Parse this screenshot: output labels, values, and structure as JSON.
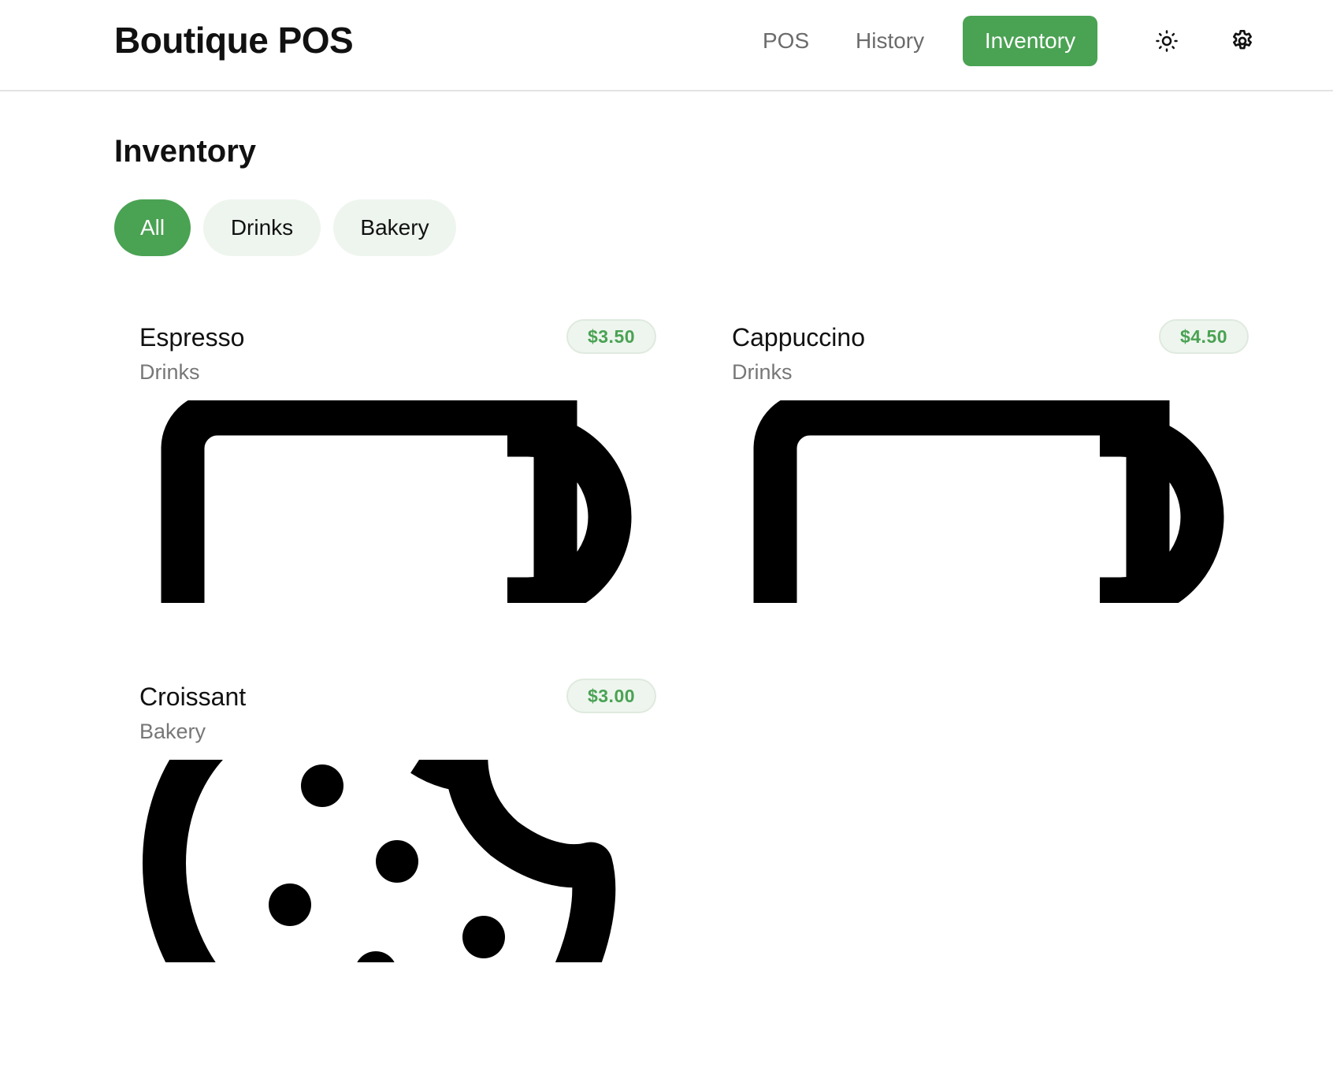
{
  "header": {
    "title": "Boutique POS",
    "nav": [
      {
        "label": "POS",
        "active": false
      },
      {
        "label": "History",
        "active": false
      },
      {
        "label": "Inventory",
        "active": true
      }
    ],
    "theme_icon": "sun-icon",
    "settings_icon": "gear-icon"
  },
  "page": {
    "title": "Inventory",
    "filters": [
      {
        "label": "All",
        "active": true
      },
      {
        "label": "Drinks",
        "active": false
      },
      {
        "label": "Bakery",
        "active": false
      }
    ]
  },
  "products": [
    {
      "name": "Espresso",
      "category": "Drinks",
      "price": "$3.50",
      "icon": "coffee-cup-icon"
    },
    {
      "name": "Cappuccino",
      "category": "Drinks",
      "price": "$4.50",
      "icon": "coffee-cup-icon"
    },
    {
      "name": "Croissant",
      "category": "Bakery",
      "price": "$3.00",
      "icon": "cookie-icon"
    }
  ],
  "colors": {
    "accent": "#4aa253",
    "chip_bg": "#eef5ee",
    "muted_text": "#777777"
  }
}
